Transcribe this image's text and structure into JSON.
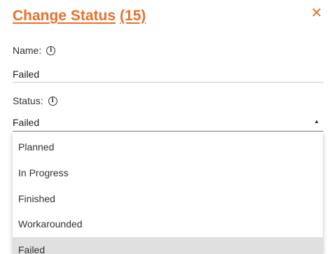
{
  "dialog": {
    "title": "Change Status",
    "count": "(15)",
    "close_glyph": "✕",
    "accent_color": "#e8702a"
  },
  "name": {
    "label": "Name:",
    "info_glyph": "i",
    "value": "Failed"
  },
  "status": {
    "label": "Status:",
    "info_glyph": "i",
    "value": "Failed",
    "caret_glyph": "▲"
  },
  "options": [
    {
      "label": "Planned"
    },
    {
      "label": "In Progress"
    },
    {
      "label": "Finished"
    },
    {
      "label": "Workarounded"
    },
    {
      "label": "Failed",
      "selected": true
    }
  ]
}
